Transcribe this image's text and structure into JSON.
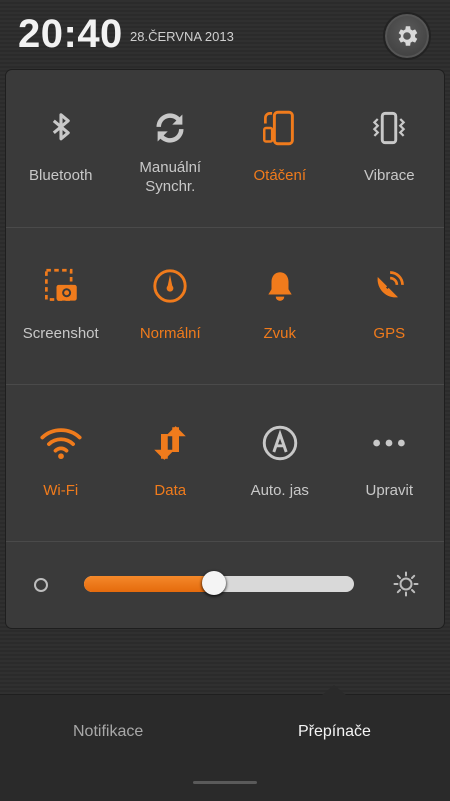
{
  "status": {
    "time": "20:40",
    "date": "28.ČERVNA 2013"
  },
  "toggles": {
    "row1": [
      {
        "label": "Bluetooth",
        "icon": "bluetooth-icon",
        "state": "off"
      },
      {
        "label": "Manuální\nSynchr.",
        "icon": "sync-icon",
        "state": "off"
      },
      {
        "label": "Otáčení",
        "icon": "rotation-icon",
        "state": "on"
      },
      {
        "label": "Vibrace",
        "icon": "vibrate-icon",
        "state": "off"
      }
    ],
    "row2": [
      {
        "label": "Screenshot",
        "icon": "screenshot-icon",
        "state": "off"
      },
      {
        "label": "Normální",
        "icon": "speedometer-icon",
        "state": "on"
      },
      {
        "label": "Zvuk",
        "icon": "bell-icon",
        "state": "on"
      },
      {
        "label": "GPS",
        "icon": "gps-icon",
        "state": "on"
      }
    ],
    "row3": [
      {
        "label": "Wi-Fi",
        "icon": "wifi-icon",
        "state": "on"
      },
      {
        "label": "Data",
        "icon": "data-icon",
        "state": "on"
      },
      {
        "label": "Auto. jas",
        "icon": "auto-brightness-icon",
        "state": "off"
      },
      {
        "label": "Upravit",
        "icon": "more-icon",
        "state": "off"
      }
    ]
  },
  "brightness": {
    "level_percent": 48
  },
  "tabs": {
    "notifications": "Notifikace",
    "switches": "Přepínače",
    "active": "switches"
  },
  "colors": {
    "accent": "#f07b1c",
    "inactive": "#c8c8c8"
  }
}
